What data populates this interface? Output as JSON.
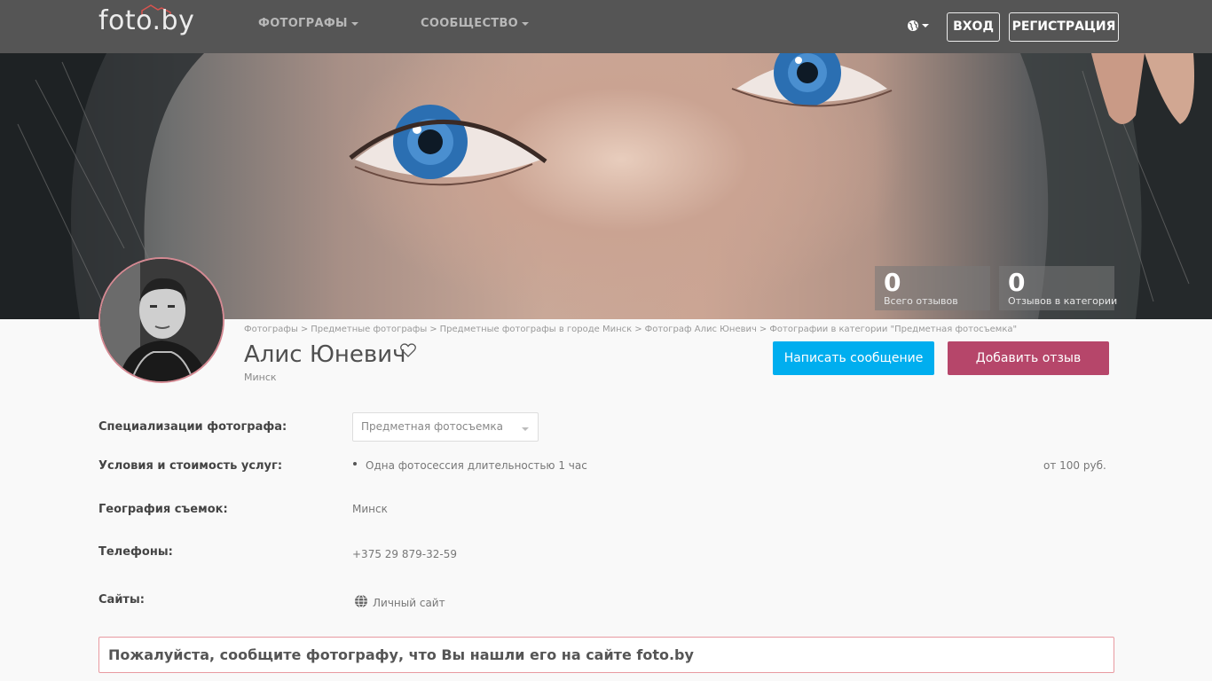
{
  "header": {
    "logo": "foto.by",
    "nav": [
      {
        "label": "ФОТОГРАФЫ"
      },
      {
        "label": "СООБЩЕСТВО"
      }
    ],
    "language_icon": "globe-icon",
    "login_label": "ВХОД",
    "register_label": "РЕГИСТРАЦИЯ"
  },
  "stats": [
    {
      "value": "0",
      "label": "Всего отзывов"
    },
    {
      "value": "0",
      "label": "Отзывов в категории"
    }
  ],
  "breadcrumb": [
    "Фотографы",
    "Предметные фотографы",
    "Предметные фотографы в городе Минск",
    "Фотограф Алис Юневич",
    "Фотографии в категории \"Предметная фотосъемка\""
  ],
  "profile": {
    "name": "Алис Юневич",
    "city": "Минск",
    "favorite_icon": "heart-icon"
  },
  "actions": {
    "message_label": "Написать сообщение",
    "review_label": "Добавить отзыв"
  },
  "details": {
    "specializations_label": "Специализации фотографа:",
    "specialization_selected": "Предметная фотосъемка",
    "services_label": "Условия и стоимость услуг:",
    "service_name": "Одна фотосессия длительностью 1 час",
    "service_price": "от 100 руб.",
    "geography_label": "География съемок:",
    "geography_value": "Минск",
    "phones_label": "Телефоны:",
    "phone_value": "+375 29 879-32-59",
    "sites_label": "Сайты:",
    "site_value": "Личный сайт"
  },
  "notice": "Пожалуйста, сообщите фотографу, что Вы нашли его на сайте foto.by",
  "colors": {
    "header_bg": "#555555",
    "message_button": "#00aeef",
    "review_button": "#b6466a",
    "notice_border": "#e89aa1"
  }
}
